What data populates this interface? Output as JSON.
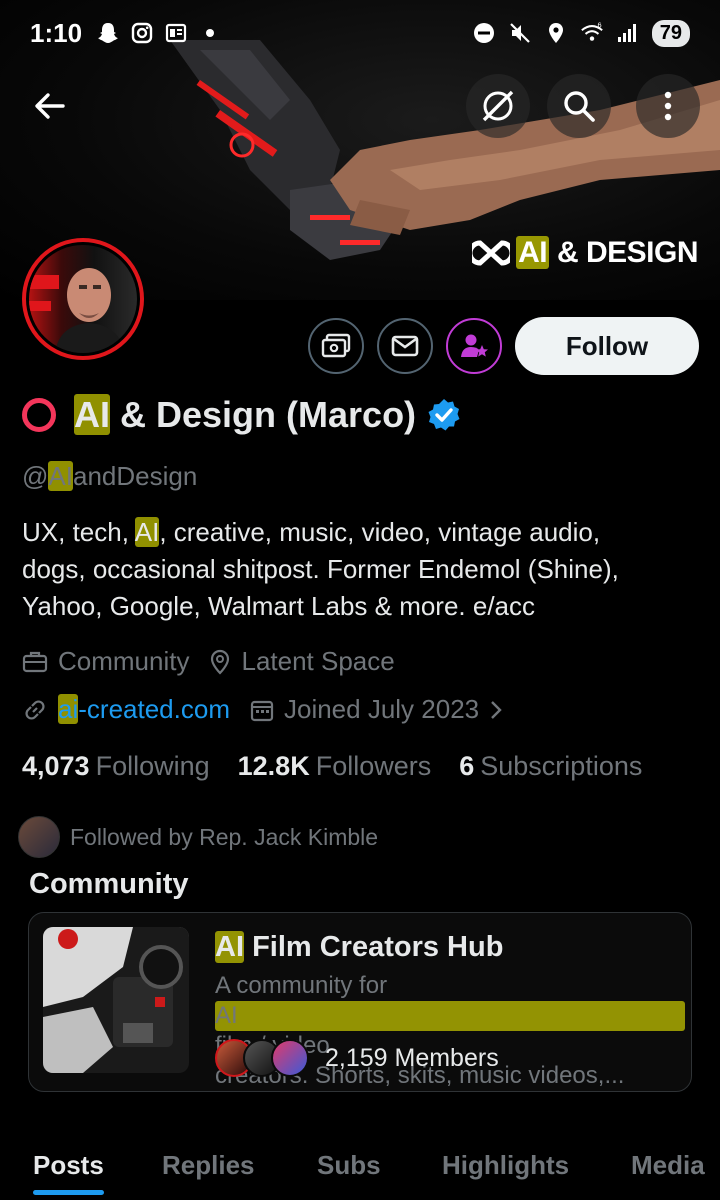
{
  "status_bar": {
    "time": "1:10",
    "battery": "79",
    "signal_label": "6"
  },
  "banner": {
    "logo_hl": "AI",
    "logo_rest": "& DESIGN"
  },
  "profile": {
    "name_hl": "AI",
    "name_rest": "& Design (Marco)",
    "handle_prefix": "@",
    "handle_hl": "AI",
    "handle_rest": "andDesign",
    "bio_lines": [
      {
        "pre": "UX, tech, ",
        "hl": "AI",
        "post": ", creative, music, video, vintage audio,"
      },
      {
        "text": "dogs, occasional shitpost. Former Endemol (Shine),"
      },
      {
        "text": "Yahoo, Google, Walmart Labs & more.   e/acc"
      }
    ],
    "category": "Community",
    "location": "Latent Space",
    "website_hl": "ai",
    "website_rest": "-created.com",
    "joined": "Joined July 2023"
  },
  "actions": {
    "follow_label": "Follow"
  },
  "stats": {
    "following_count": "4,073",
    "following_label": "Following",
    "followers_count": "12.8K",
    "followers_label": "Followers",
    "subscriptions_count": "6",
    "subscriptions_label": "Subscriptions"
  },
  "followed_by": "Followed by Rep. Jack Kimble",
  "community": {
    "section_title": "Community",
    "name_hl": "AI",
    "name_rest": "Film Creators Hub",
    "desc_line1_pre": "A community for ",
    "desc_line1_hl": "AI",
    "desc_line1_post": " film / video",
    "desc_line2": "creators. Shorts, skits, music videos,...",
    "members": "2,159 Members"
  },
  "tabs": [
    "Posts",
    "Replies",
    "Subs",
    "Highlights",
    "Media"
  ],
  "colors": {
    "accent": "#1d9bf0",
    "highlight": "#c8c800",
    "avatar_ring": "#e0161b",
    "subscribe_purple": "#c13cd6",
    "name_ring": "#f4365b"
  }
}
